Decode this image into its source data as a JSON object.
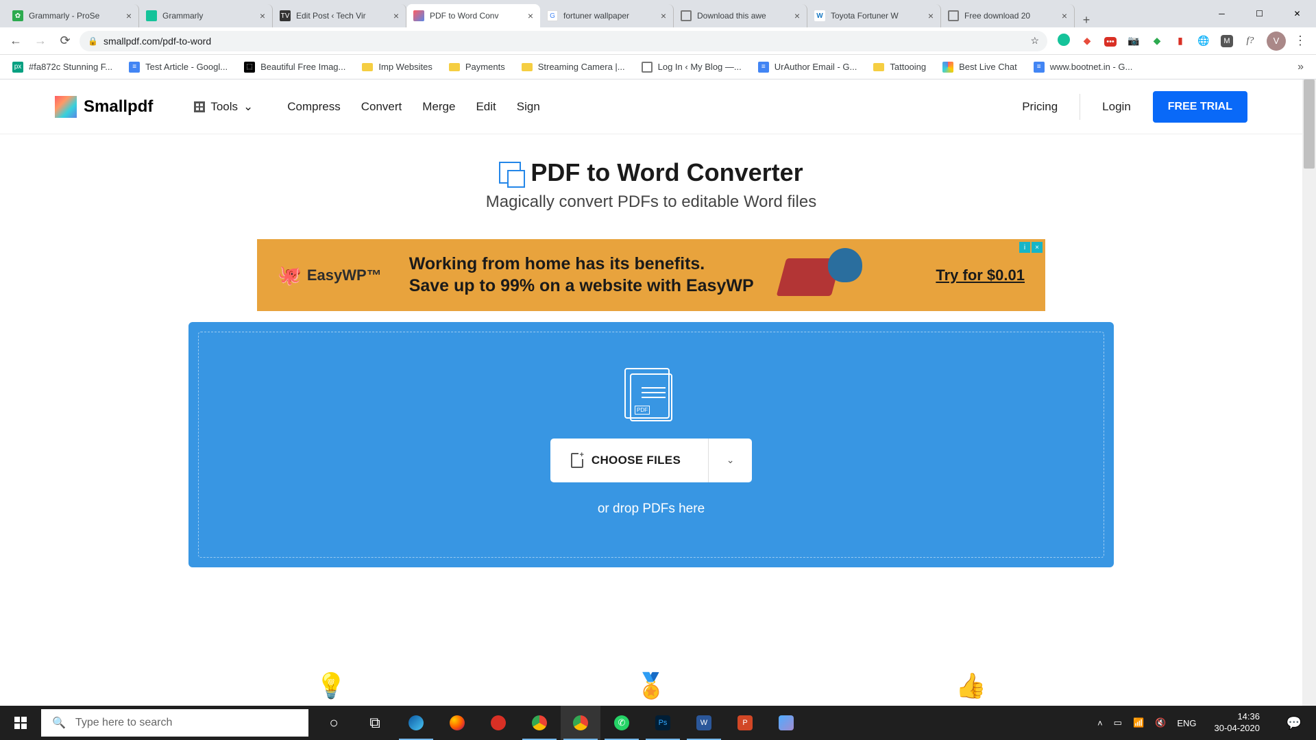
{
  "browser": {
    "tabs": [
      {
        "title": "Grammarly - ProSe"
      },
      {
        "title": "Grammarly"
      },
      {
        "title": "Edit Post ‹ Tech Vir"
      },
      {
        "title": "PDF to Word Conv"
      },
      {
        "title": "fortuner wallpaper"
      },
      {
        "title": "Download this awe"
      },
      {
        "title": "Toyota Fortuner W"
      },
      {
        "title": "Free download 20"
      }
    ],
    "url": "smallpdf.com/pdf-to-word",
    "avatar": "V",
    "f_ext": "f?",
    "bookmarks": [
      "#fa872c Stunning F...",
      "Test Article - Googl...",
      "Beautiful Free Imag...",
      "Imp Websites",
      "Payments",
      "Streaming Camera |...",
      "Log In ‹ My Blog —...",
      "UrAuthor Email - G...",
      "Tattooing",
      "Best Live Chat",
      "www.bootnet.in - G..."
    ]
  },
  "site": {
    "brand": "Smallpdf",
    "tools": "Tools",
    "nav": {
      "compress": "Compress",
      "convert": "Convert",
      "merge": "Merge",
      "edit": "Edit",
      "sign": "Sign"
    },
    "pricing": "Pricing",
    "login": "Login",
    "trial": "FREE TRIAL"
  },
  "hero": {
    "title": "PDF to Word Converter",
    "subtitle": "Magically convert PDFs to editable Word files"
  },
  "ad": {
    "brand": "EasyWP™",
    "line1": "Working from home has its benefits.",
    "line2": "Save up to 99% on a website with EasyWP",
    "cta": "Try for $0.01"
  },
  "dropzone": {
    "choose": "CHOOSE FILES",
    "hint": "or drop PDFs here",
    "pdf": "PDF"
  },
  "taskbar": {
    "search_placeholder": "Type here to search",
    "lang": "ENG",
    "time": "14:36",
    "date": "30-04-2020"
  }
}
